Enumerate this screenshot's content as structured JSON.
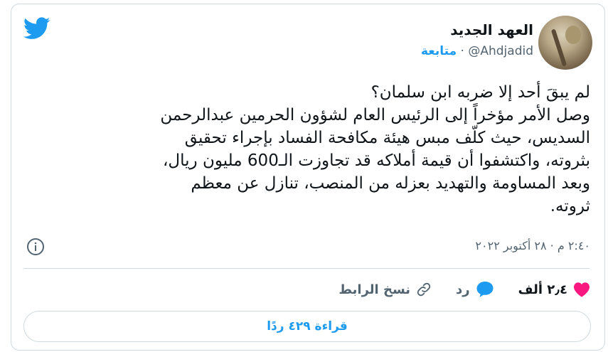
{
  "author": {
    "name": "العهد الجديد",
    "handle": "@Ahdjadid",
    "separator": "·",
    "follow_label": "متابعة"
  },
  "tweet": {
    "lines": [
      "لم يبقَ أحد إلا ضربه ابن سلمان؟",
      "وصل الأمر مؤخراً إلى الرئيس العام لشؤون الحرمين عبدالرحمن",
      "السديس، حيث كلّف مبس هيئة مكافحة الفساد بإجراء تحقيق",
      "بثروته، واكتشفوا أن قيمة أملاكه قد تجاوزت الـ600 مليون ريال،",
      "وبعد المساومة والتهديد بعزله من المنصب، تنازل عن معظم",
      "ثروته."
    ],
    "timestamp": "٢:٤٠ م · ٢٨ أكتوبر ٢٠٢٢"
  },
  "actions": {
    "like_count": "٢٫٤ ألف",
    "reply_label": "رد",
    "copy_link_label": "نسخ الرابط"
  },
  "read_replies_label": "قراءة ٤٢٩ ردًا",
  "colors": {
    "accent": "#1d9bf0",
    "like": "#f91880",
    "muted": "#536471",
    "border": "#cfd9de"
  },
  "icons": [
    "twitter-bird-icon",
    "info-icon",
    "heart-icon",
    "reply-bubble-icon",
    "link-icon"
  ]
}
